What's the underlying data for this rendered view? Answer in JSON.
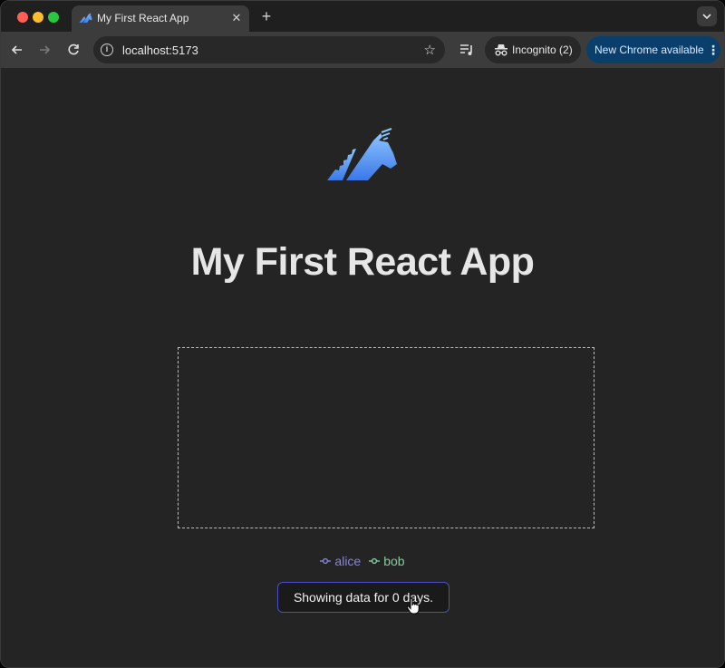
{
  "browser": {
    "tab_title": "My First React App",
    "url": "localhost:5173",
    "incognito_label": "Incognito (2)",
    "update_label": "New Chrome available"
  },
  "page": {
    "heading": "My First React App",
    "days_button_label": "Showing data for 0 days."
  },
  "chart_data": {
    "type": "line",
    "series": [
      {
        "name": "alice",
        "values": [],
        "color": "#8884d8"
      },
      {
        "name": "bob",
        "values": [],
        "color": "#82ca9d"
      }
    ],
    "legend": "bottom",
    "grid": false
  },
  "colors": {
    "page_background": "#242424",
    "heading_text": "#e6e6e6",
    "button_border": "#4a4ec8",
    "alice": "#8884d8",
    "bob": "#82ca9d"
  },
  "icons": {
    "favicon": "unicorn-icon",
    "logo": "unicorn-logo",
    "info": "info-icon",
    "bookmark": "star-icon",
    "media": "media-queue-icon",
    "incognito": "incognito-icon",
    "menu": "more-vert-icon",
    "cursor": "hand-pointer-icon"
  }
}
